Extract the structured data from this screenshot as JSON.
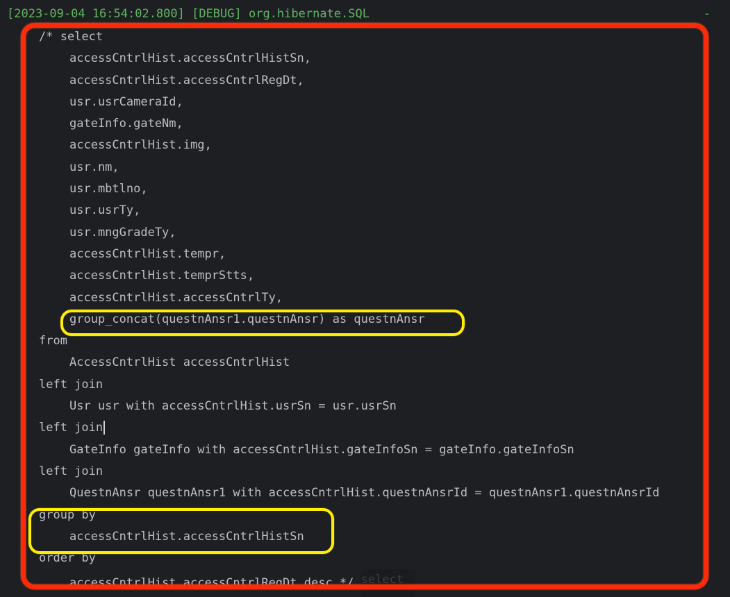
{
  "log": {
    "header": "[2023-09-04 16:54:02.800] [DEBUG] org.hibernate.SQL",
    "header_trailing": "-",
    "lines": [
      {
        "indent": 0,
        "text": "/* select"
      },
      {
        "indent": 1,
        "text": "accessCntrlHist.accessCntrlHistSn,"
      },
      {
        "indent": 1,
        "text": "accessCntrlHist.accessCntrlRegDt,"
      },
      {
        "indent": 1,
        "text": "usr.usrCameraId,"
      },
      {
        "indent": 1,
        "text": "gateInfo.gateNm,"
      },
      {
        "indent": 1,
        "text": "accessCntrlHist.img,"
      },
      {
        "indent": 1,
        "text": "usr.nm,"
      },
      {
        "indent": 1,
        "text": "usr.mbtlno,"
      },
      {
        "indent": 1,
        "text": "usr.usrTy,"
      },
      {
        "indent": 1,
        "text": "usr.mngGradeTy,"
      },
      {
        "indent": 1,
        "text": "accessCntrlHist.tempr,"
      },
      {
        "indent": 1,
        "text": "accessCntrlHist.temprStts,"
      },
      {
        "indent": 1,
        "text": "accessCntrlHist.accessCntrlTy,"
      },
      {
        "indent": 1,
        "text": "group_concat(questnAnsr1.questnAnsr) as questnAnsr"
      },
      {
        "indent": 0,
        "text": "from"
      },
      {
        "indent": 1,
        "text": "AccessCntrlHist accessCntrlHist"
      },
      {
        "indent": 0,
        "text": "left join"
      },
      {
        "indent": 1,
        "text": "Usr usr with accessCntrlHist.usrSn = usr.usrSn"
      },
      {
        "indent": 0,
        "text": "left join",
        "caret": true
      },
      {
        "indent": 1,
        "text": "GateInfo gateInfo with accessCntrlHist.gateInfoSn = gateInfo.gateInfoSn"
      },
      {
        "indent": 0,
        "text": "left join"
      },
      {
        "indent": 1,
        "text": "QuestnAnsr questnAnsr1 with accessCntrlHist.questnAnsrId = questnAnsr1.questnAnsrId"
      },
      {
        "indent": 0,
        "text": "group by"
      },
      {
        "indent": 1,
        "text": "accessCntrlHist.accessCntrlHistSn"
      },
      {
        "indent": 0,
        "text": "order by"
      },
      {
        "indent": 1,
        "text": "accessCntrlHist.accessCntrlRegDt desc */",
        "tail": "select"
      }
    ]
  },
  "annotations": {
    "red_outline_color": "#ff2a0a",
    "yellow_outline_color": "#ffee00"
  },
  "colors": {
    "background": "#1e1f22",
    "text": "#bcbec4",
    "log_header": "#5fb760"
  }
}
